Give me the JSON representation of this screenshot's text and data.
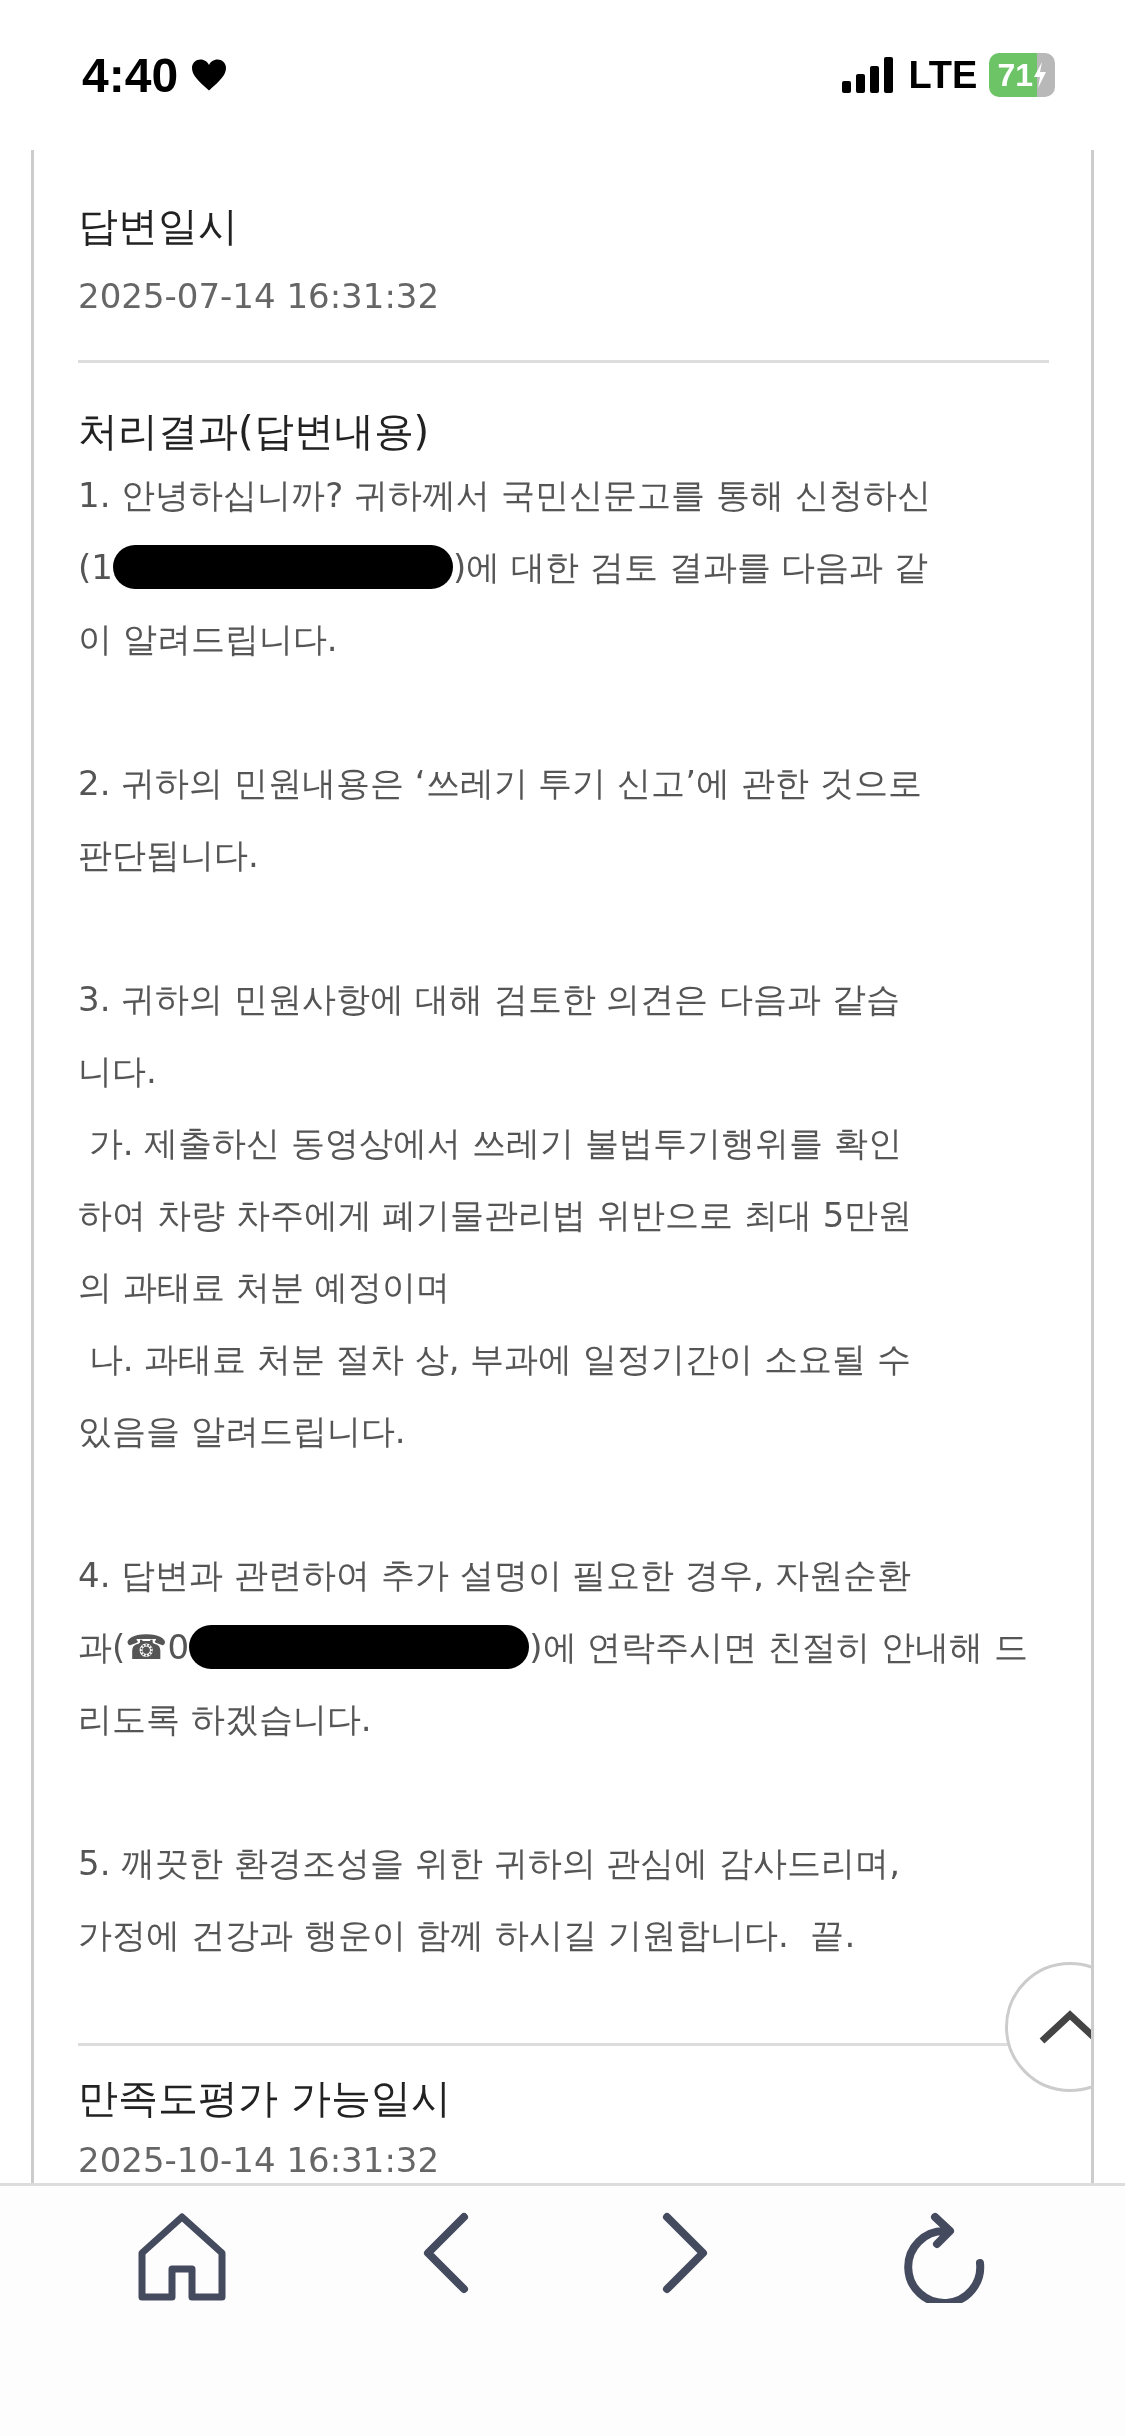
{
  "status_bar": {
    "time": "4:40",
    "network": "LTE",
    "battery": "71"
  },
  "answer_date": {
    "label": "답변일시",
    "value": "2025-07-14 16:31:32"
  },
  "answer": {
    "label": "처리결과(답변내용)",
    "paragraphs": [
      [
        [
          {
            "kind": "text",
            "text": "1. 안녕하십니까? 귀하께서 국민신문고를 통해 신청하신"
          }
        ],
        [
          {
            "kind": "text",
            "text": "(1"
          },
          {
            "kind": "redacted"
          },
          {
            "kind": "text",
            "text": ")에 대한 검토 결과를 다음과 같"
          }
        ],
        [
          {
            "kind": "text",
            "text": "이 알려드립니다."
          }
        ]
      ],
      [
        [
          {
            "kind": "text",
            "text": "2. 귀하의 민원내용은 ‘쓰레기 투기 신고’에 관한 것으로"
          }
        ],
        [
          {
            "kind": "text",
            "text": "판단됩니다."
          }
        ]
      ],
      [
        [
          {
            "kind": "text",
            "text": "3. 귀하의 민원사항에 대해 검토한 의견은 다음과 같습"
          }
        ],
        [
          {
            "kind": "text",
            "text": "니다."
          }
        ],
        [
          {
            "kind": "text",
            "text": " 가. 제출하신 동영상에서 쓰레기 불법투기행위를 확인"
          }
        ],
        [
          {
            "kind": "text",
            "text": "하여 차량 차주에게 폐기물관리법 위반으로 최대 5만원"
          }
        ],
        [
          {
            "kind": "text",
            "text": "의 과태료 처분 예정이며"
          }
        ],
        [
          {
            "kind": "text",
            "text": " 나. 과태료 처분 절차 상, 부과에 일정기간이 소요될 수"
          }
        ],
        [
          {
            "kind": "text",
            "text": "있음을 알려드립니다."
          }
        ]
      ],
      [
        [
          {
            "kind": "text",
            "text": "4. 답변과 관련하여 추가 설명이 필요한 경우, 자원순환"
          }
        ],
        [
          {
            "kind": "text",
            "text": "과(☎0"
          },
          {
            "kind": "redacted"
          },
          {
            "kind": "text",
            "text": ")에 연락주시면 친절히 안내해 드"
          }
        ],
        [
          {
            "kind": "text",
            "text": "리도록 하겠습니다."
          }
        ]
      ],
      [
        [
          {
            "kind": "text",
            "text": "5. 깨끗한 환경조성을 위한 귀하의 관심에 감사드리며,"
          }
        ],
        [
          {
            "kind": "text",
            "text": "가정에 건강과 행운이 함께 하시길 기원합니다.  끝."
          }
        ]
      ]
    ]
  },
  "rating_date": {
    "label": "만족도평가 가능일시",
    "value": "2025-10-14 16:31:32"
  }
}
